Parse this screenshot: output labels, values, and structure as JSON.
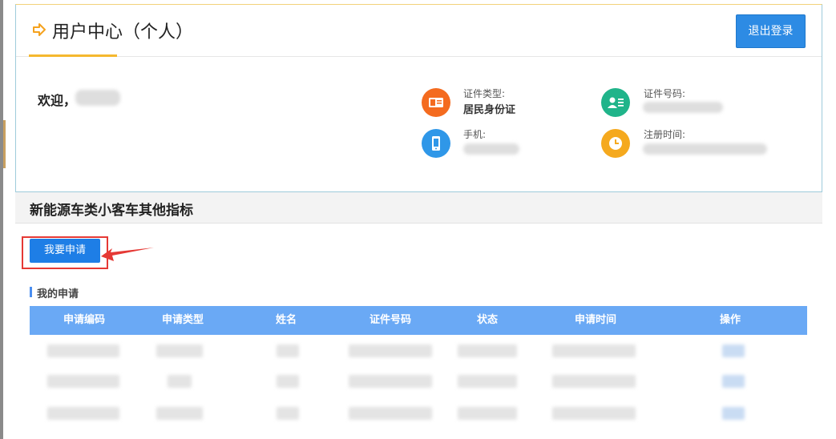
{
  "user_center": {
    "title": "用户中心（个人）",
    "logout_label": "退出登录",
    "welcome_label": "欢迎，",
    "info": [
      {
        "label": "证件类型:",
        "value": "居民身份证",
        "icon": "id-card-icon",
        "color": "#f46b1f"
      },
      {
        "label": "证件号码:",
        "value": "",
        "icon": "id-number-icon",
        "color": "#20b48a"
      },
      {
        "label": "手机:",
        "value": "",
        "icon": "phone-icon",
        "color": "#2f97e8"
      },
      {
        "label": "注册时间:",
        "value": "",
        "icon": "clock-icon",
        "color": "#f5a91e"
      }
    ]
  },
  "section": {
    "title": "新能源车类小客车其他指标",
    "apply_label": "我要申请",
    "my_apply_label": "我的申请"
  },
  "table": {
    "columns": [
      "申请编码",
      "申请类型",
      "姓名",
      "证件号码",
      "状态",
      "申请时间",
      "操作"
    ]
  },
  "colors": {
    "primary_button": "#2d8be4",
    "table_header": "#6aa9f5",
    "accent_underline": "#f5b82e",
    "highlight_outline": "#e53935"
  }
}
